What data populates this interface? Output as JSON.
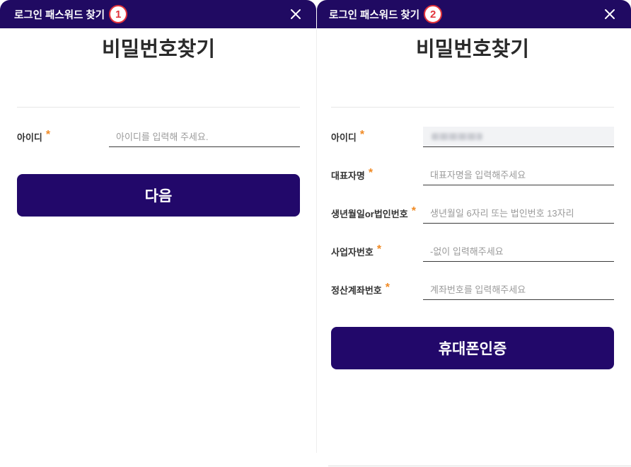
{
  "colors": {
    "header_bg": "#200a62",
    "button_bg": "#22086a",
    "required": "#f08a24",
    "badge": "#e2333b",
    "text": "#333333",
    "placeholder": "#9a9a9a"
  },
  "icons": {
    "close": "close-icon"
  },
  "required_mark": "*",
  "panels": [
    {
      "header": {
        "title": "로그인 패스워드 찾기",
        "step_badge": "1"
      },
      "heading": "비밀번호찾기",
      "fields": [
        {
          "label": "아이디",
          "placeholder": "아이디를 입력해 주세요."
        }
      ],
      "submit_button": "다음"
    },
    {
      "header": {
        "title": "로그인 패스워드 찾기",
        "step_badge": "2"
      },
      "heading": "비밀번호찾기",
      "fields": [
        {
          "label": "아이디"
        },
        {
          "label": "대표자명",
          "placeholder": "대표자명을 입력해주세요"
        },
        {
          "label": "생년월일or법인번호",
          "placeholder": "생년월일 6자리 또는 법인번호 13자리"
        },
        {
          "label": "사업자번호",
          "placeholder": "-없이 입력해주세요"
        },
        {
          "label": "정산계좌번호",
          "placeholder": "계좌번호를 입력해주세요"
        }
      ],
      "submit_button": "휴대폰인증"
    }
  ]
}
